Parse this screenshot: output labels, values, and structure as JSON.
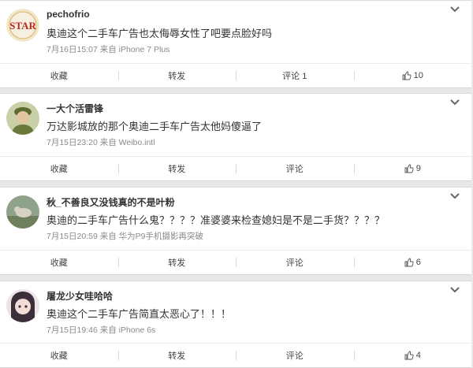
{
  "comments": [
    {
      "username": "pechofrio",
      "text": "奥迪这个二手车广告也太侮辱女性了吧要点脸好吗",
      "meta": "7月16日15:07 来自 iPhone 7 Plus",
      "avatar_text": "STAR",
      "actions": {
        "collect": "收藏",
        "repost": "转发",
        "comment": "评论 1",
        "like": "10"
      }
    },
    {
      "username": "一大个活雷锋",
      "text": "万达影城放的那个奥迪二手车广告太他妈傻逼了",
      "meta": "7月15日23:20 来自 Weibo.intl",
      "actions": {
        "collect": "收藏",
        "repost": "转发",
        "comment": "评论",
        "like": "9"
      }
    },
    {
      "username": "秋_不善良又没钱真的不是叶粉",
      "text": "奥迪的二手车广告什么鬼？？？？准婆婆来检查媳妇是不是二手货？？？？",
      "meta": "7月15日20:59 来自 华为P9手机摄影再突破",
      "actions": {
        "collect": "收藏",
        "repost": "转发",
        "comment": "评论",
        "like": "6"
      }
    },
    {
      "username": "屠龙少女哇哈哈",
      "text": "奥迪这个二手车广告简直太恶心了！！！",
      "meta": "7月15日19:46 来自 iPhone 6s",
      "actions": {
        "collect": "收藏",
        "repost": "转发",
        "comment": "评论",
        "like": "4"
      }
    }
  ],
  "icons": {
    "expand": "chevron-down-icon",
    "like": "thumbs-up-icon"
  },
  "colors": {
    "background": "#e8e8ea",
    "card": "#ffffff",
    "meta": "#8a8a8a"
  }
}
